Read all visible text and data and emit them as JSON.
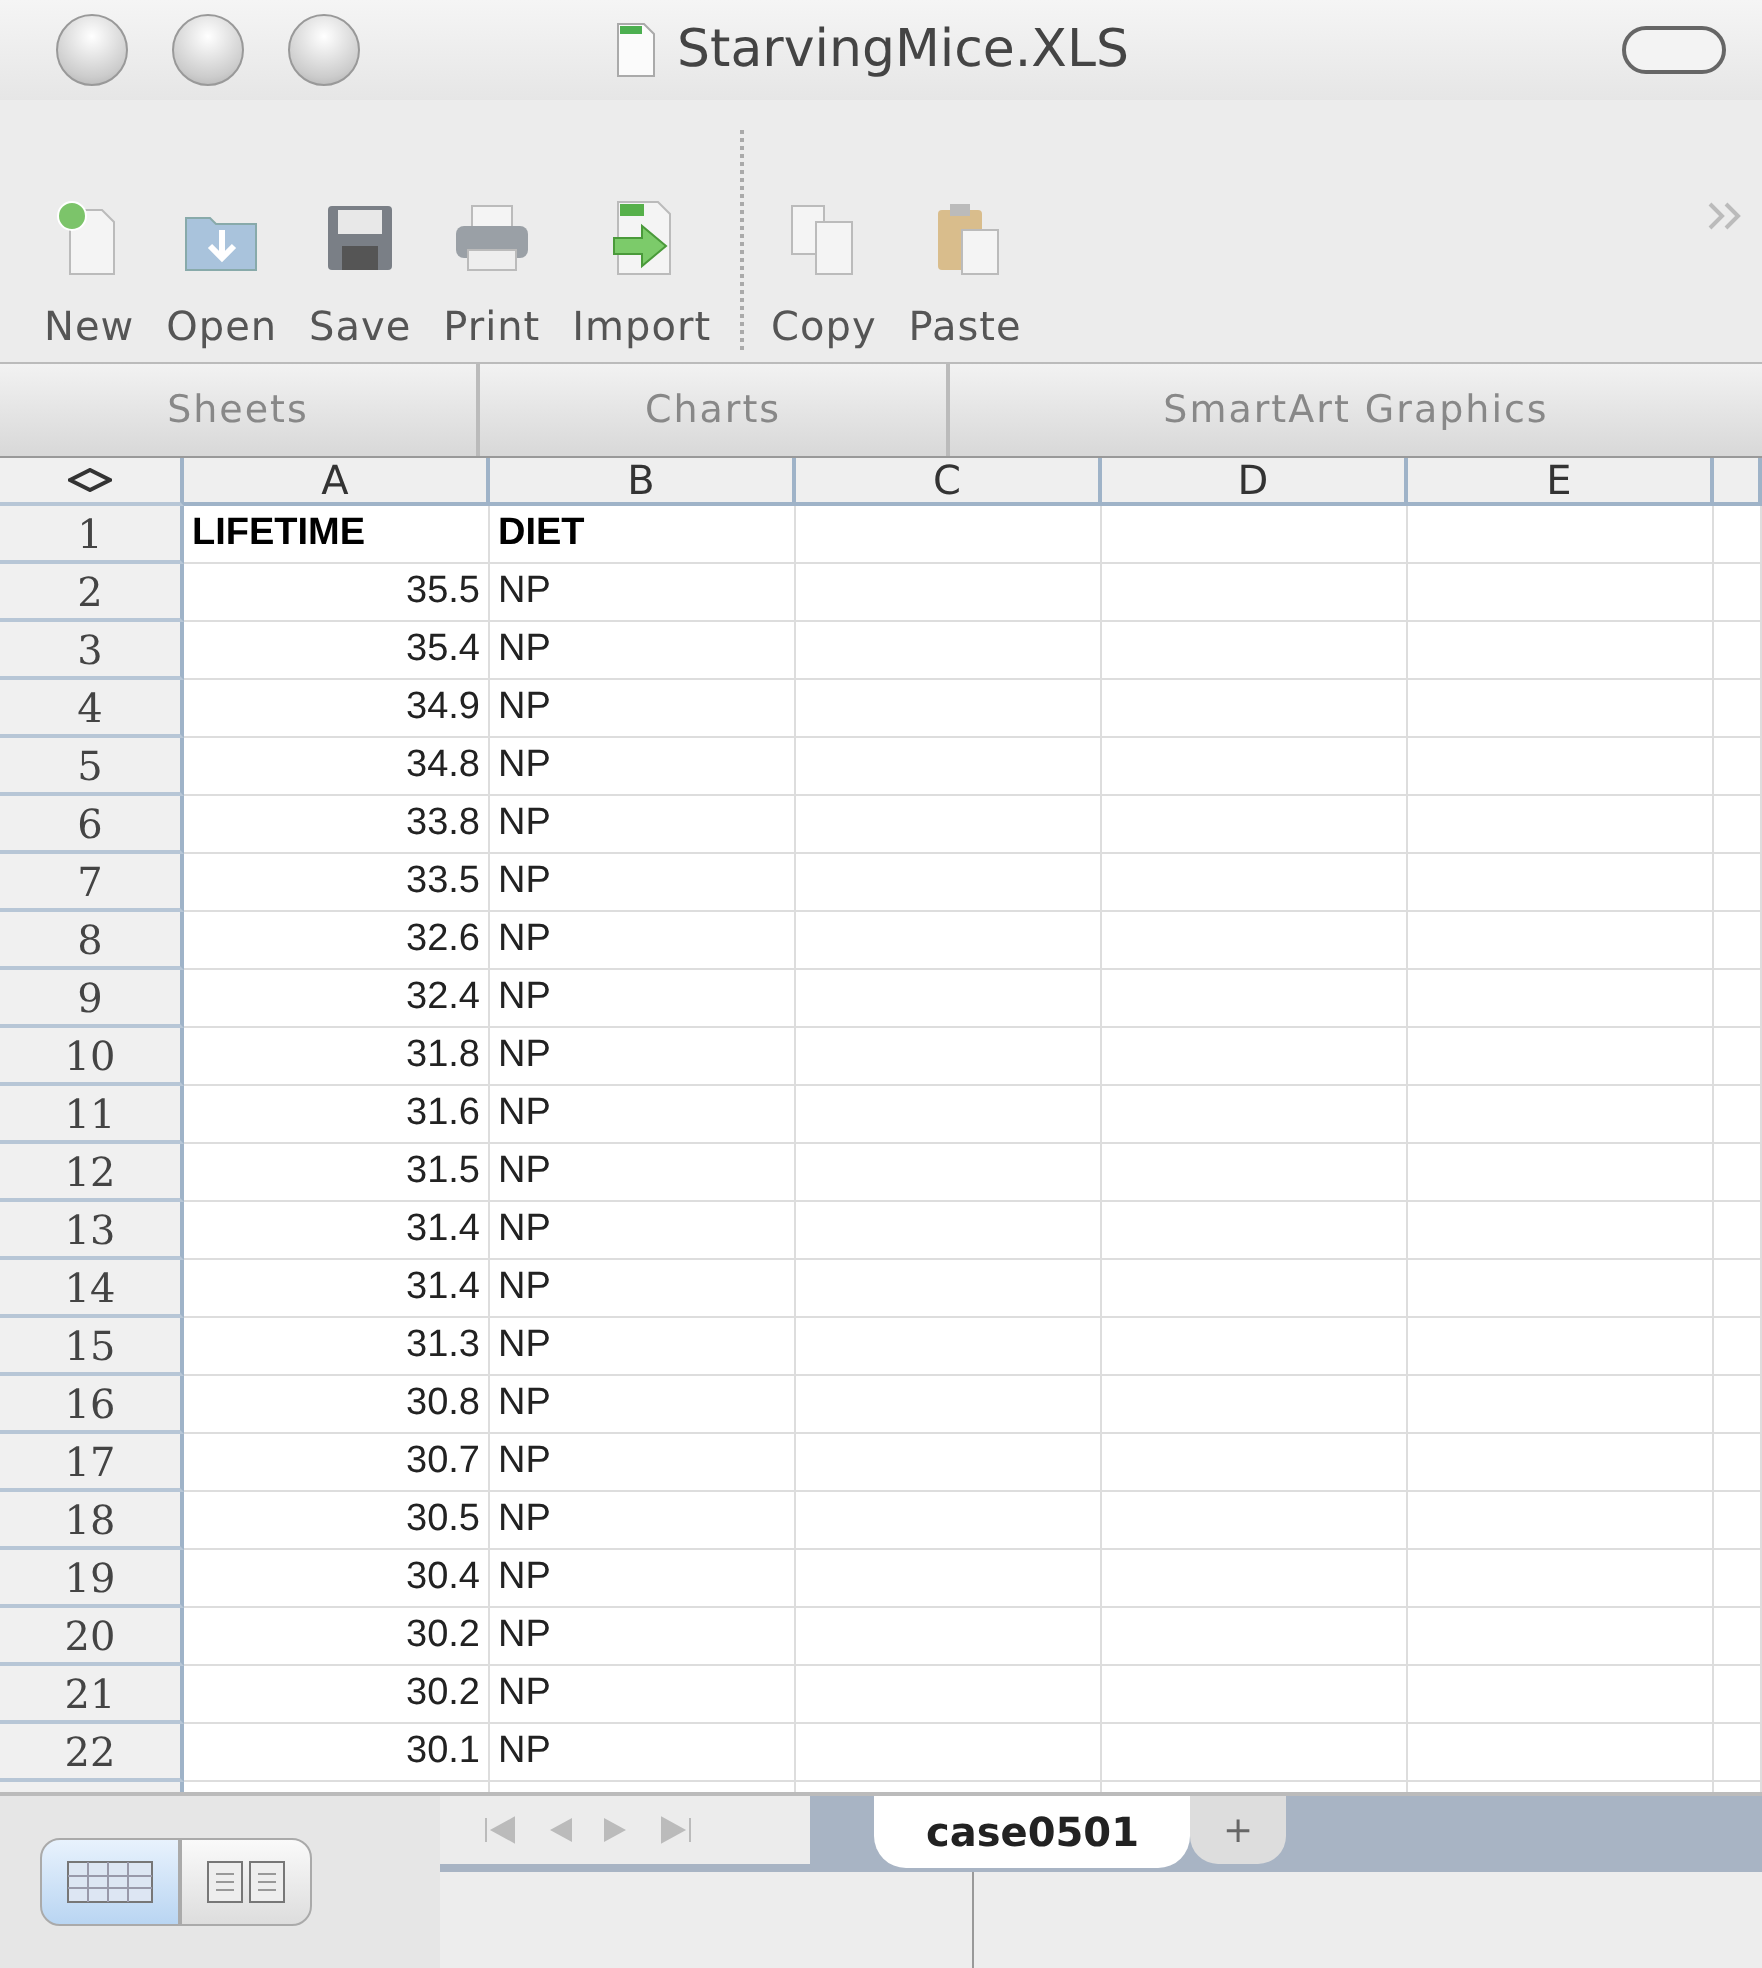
{
  "window": {
    "title": "StarvingMice.XLS"
  },
  "toolbar": [
    {
      "kind": "new",
      "label": "New"
    },
    {
      "kind": "open",
      "label": "Open"
    },
    {
      "kind": "save",
      "label": "Save"
    },
    {
      "kind": "print",
      "label": "Print"
    },
    {
      "kind": "import",
      "label": "Import"
    },
    {
      "kind": "copy",
      "label": "Copy"
    },
    {
      "kind": "paste",
      "label": "Paste"
    }
  ],
  "ribbon_tabs": [
    "Sheets",
    "Charts",
    "SmartArt Graphics"
  ],
  "sheet": {
    "columns": [
      "A",
      "B",
      "C",
      "D",
      "E"
    ],
    "rows": [
      {
        "number": "1",
        "kind": "header",
        "cells": [
          "LIFETIME",
          "DIET"
        ]
      },
      {
        "number": "2",
        "kind": "data",
        "cells": [
          "35.5",
          "NP"
        ]
      },
      {
        "number": "3",
        "kind": "data",
        "cells": [
          "35.4",
          "NP"
        ]
      },
      {
        "number": "4",
        "kind": "data",
        "cells": [
          "34.9",
          "NP"
        ]
      },
      {
        "number": "5",
        "kind": "data",
        "cells": [
          "34.8",
          "NP"
        ]
      },
      {
        "number": "6",
        "kind": "data",
        "cells": [
          "33.8",
          "NP"
        ]
      },
      {
        "number": "7",
        "kind": "data",
        "cells": [
          "33.5",
          "NP"
        ]
      },
      {
        "number": "8",
        "kind": "data",
        "cells": [
          "32.6",
          "NP"
        ]
      },
      {
        "number": "9",
        "kind": "data",
        "cells": [
          "32.4",
          "NP"
        ]
      },
      {
        "number": "10",
        "kind": "data",
        "cells": [
          "31.8",
          "NP"
        ]
      },
      {
        "number": "11",
        "kind": "data",
        "cells": [
          "31.6",
          "NP"
        ]
      },
      {
        "number": "12",
        "kind": "data",
        "cells": [
          "31.5",
          "NP"
        ]
      },
      {
        "number": "13",
        "kind": "data",
        "cells": [
          "31.4",
          "NP"
        ]
      },
      {
        "number": "14",
        "kind": "data",
        "cells": [
          "31.4",
          "NP"
        ]
      },
      {
        "number": "15",
        "kind": "data",
        "cells": [
          "31.3",
          "NP"
        ]
      },
      {
        "number": "16",
        "kind": "data",
        "cells": [
          "30.8",
          "NP"
        ]
      },
      {
        "number": "17",
        "kind": "data",
        "cells": [
          "30.7",
          "NP"
        ]
      },
      {
        "number": "18",
        "kind": "data",
        "cells": [
          "30.5",
          "NP"
        ]
      },
      {
        "number": "19",
        "kind": "data",
        "cells": [
          "30.4",
          "NP"
        ]
      },
      {
        "number": "20",
        "kind": "data",
        "cells": [
          "30.2",
          "NP"
        ]
      },
      {
        "number": "21",
        "kind": "data",
        "cells": [
          "30.2",
          "NP"
        ]
      },
      {
        "number": "22",
        "kind": "data",
        "cells": [
          "30.1",
          "NP"
        ]
      }
    ]
  },
  "view_buttons": [
    {
      "kind": "normal",
      "selected": true
    },
    {
      "kind": "page-layout",
      "selected": false
    }
  ],
  "sheet_tabs": [
    {
      "label": "case0501",
      "selected": true
    }
  ],
  "add_sheet": "+"
}
